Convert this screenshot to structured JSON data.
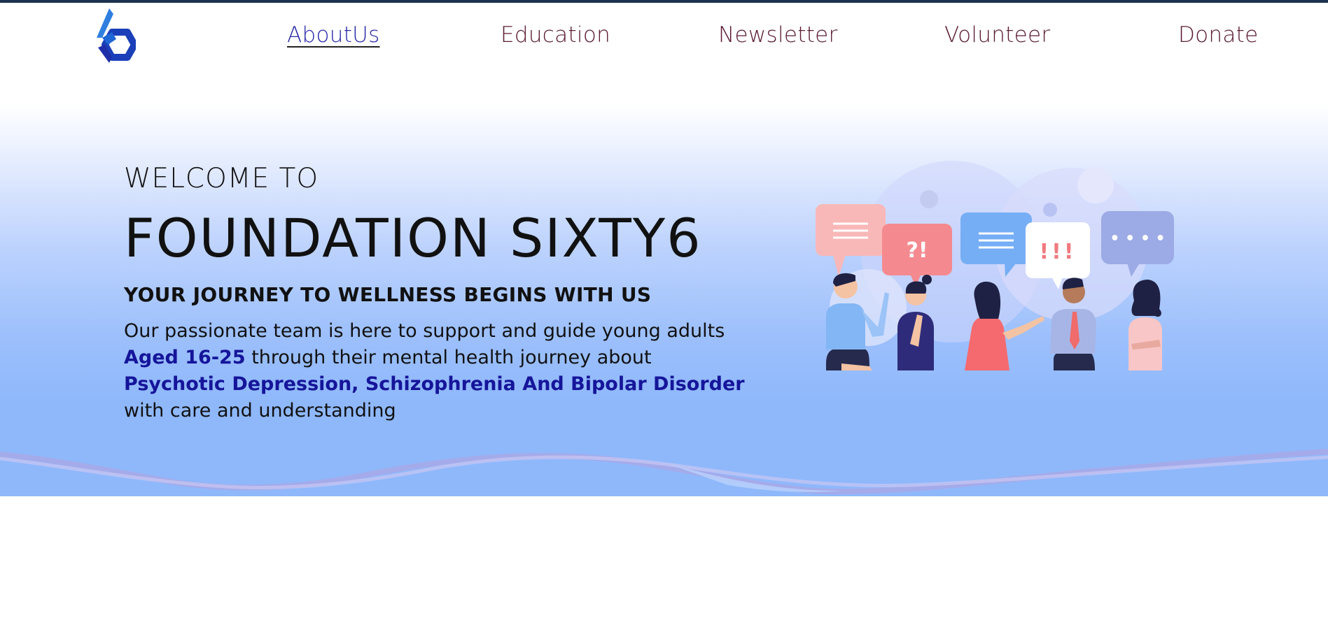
{
  "nav": {
    "logo": "foundation-sixty6-logo",
    "links": [
      {
        "label": "AboutUs",
        "active": true
      },
      {
        "label": "Education",
        "active": false
      },
      {
        "label": "Newsletter",
        "active": false
      },
      {
        "label": "Volunteer",
        "active": false
      },
      {
        "label": "Donate",
        "active": false
      }
    ]
  },
  "hero": {
    "welcome": "WELCOME TO",
    "title": "FOUNDATION SIXTY6",
    "subtitle": "YOUR JOURNEY TO WELLNESS BEGINS WITH US",
    "desc_part1": "Our passionate team is here to support and guide young adults ",
    "desc_highlight1": "Aged 16-25",
    "desc_part2": " through their mental health journey about ",
    "desc_highlight2": "Psychotic Depression, Schizophrenia And Bipolar Disorder",
    "desc_part3": " with care and understanding",
    "illustration": {
      "bubble_q": "?!",
      "bubble_excl": "!!!",
      "bubble_dots": "• • • •"
    }
  },
  "colors": {
    "top_bar": "#1b3350",
    "nav_text": "#5a1a33",
    "nav_active": "#2a2aa8",
    "highlight": "#15159a",
    "hero_blue": "#8fb8fb"
  }
}
